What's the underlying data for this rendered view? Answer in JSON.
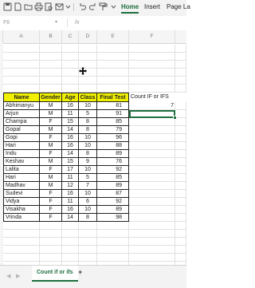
{
  "ribbon": {
    "tabs": [
      "Home",
      "Insert",
      "Page La"
    ]
  },
  "formula_bar": {
    "name_box": "F6",
    "fx_label": "fx"
  },
  "columns": [
    "",
    "A",
    "B",
    "C",
    "D",
    "E",
    "F"
  ],
  "table": {
    "headers": [
      "Name",
      "Gender",
      "Age",
      "Class",
      "Final Test"
    ],
    "rows": [
      [
        "Abhimanyu",
        "M",
        "16",
        "10",
        "81"
      ],
      [
        "Arjun",
        "M",
        "11",
        "5",
        "91"
      ],
      [
        "Champa",
        "F",
        "15",
        "8",
        "85"
      ],
      [
        "Gopal",
        "M",
        "14",
        "8",
        "79"
      ],
      [
        "Gopi",
        "F",
        "16",
        "10",
        "96"
      ],
      [
        "Hari",
        "M",
        "16",
        "10",
        "88"
      ],
      [
        "Indu",
        "F",
        "14",
        "8",
        "89"
      ],
      [
        "Keshav",
        "M",
        "15",
        "9",
        "76"
      ],
      [
        "Lalita",
        "F",
        "17",
        "10",
        "92"
      ],
      [
        "Hari",
        "M",
        "11",
        "5",
        "85"
      ],
      [
        "Madhav",
        "M",
        "12",
        "7",
        "89"
      ],
      [
        "Sudevi",
        "F",
        "16",
        "10",
        "87"
      ],
      [
        "Vidya",
        "F",
        "11",
        "6",
        "92"
      ],
      [
        "Visakha",
        "F",
        "16",
        "10",
        "89"
      ],
      [
        "Vrinda",
        "F",
        "14",
        "8",
        "98"
      ]
    ]
  },
  "side": {
    "label": "Count IF or IFS",
    "value": "7"
  },
  "sheet_tabs": {
    "active": "Count if or ifs",
    "add": "+"
  },
  "colors": {
    "accent": "#1e6f3e",
    "header_fill": "#f0f000"
  }
}
